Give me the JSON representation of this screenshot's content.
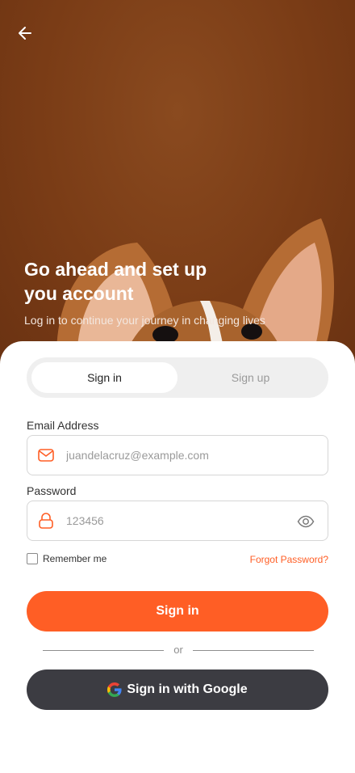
{
  "hero": {
    "title": "Go ahead and set up\nyou account",
    "subtitle": "Log in to continue your journey in changing lives"
  },
  "tabs": [
    {
      "label": "Sign in",
      "active": true
    },
    {
      "label": "Sign up",
      "active": false
    }
  ],
  "form": {
    "email": {
      "label": "Email Address",
      "placeholder": "juandelacruz@example.com",
      "icon": "mail-icon"
    },
    "password": {
      "label": "Password",
      "placeholder": "123456",
      "icon": "lock-icon"
    },
    "remember_label": "Remember me",
    "forgot_label": "Forgot Password?"
  },
  "actions": {
    "sign_in_label": "Sign in",
    "or_label": "or",
    "google_label": "Sign in with Google"
  },
  "colors": {
    "accent": "#ff5e25",
    "hero_bg": "#7a3c16",
    "google_button": "#3c3c42"
  }
}
